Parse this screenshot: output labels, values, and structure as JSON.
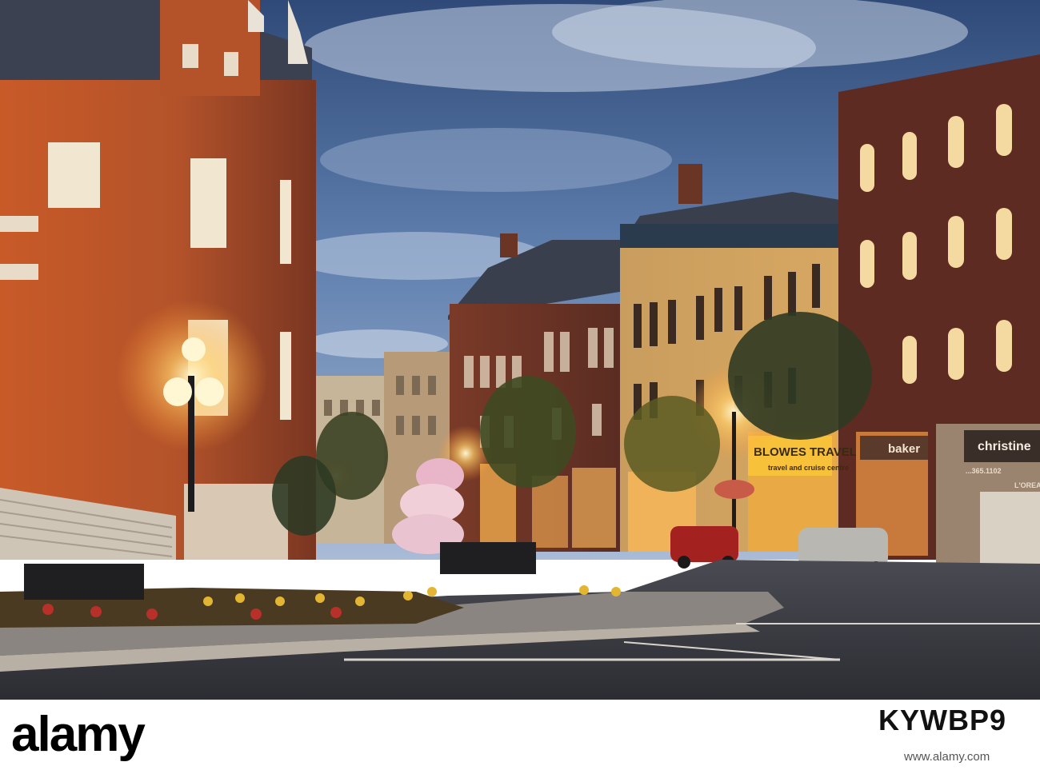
{
  "scene": {
    "signs": {
      "travel_name": "BLOWES TRAVEL",
      "travel_sub": "travel and cruise centre",
      "baker": "baker",
      "christine": "christine",
      "phone": "...365.1102",
      "loreal": "L'OREAL"
    },
    "colors": {
      "sky_top": "#3e5a88",
      "sky_bottom": "#8ba4c7",
      "brick_lit": "#c8642e",
      "brick_dark": "#6e2f1f",
      "lamp_glow": "#ffd27a",
      "road": "#3a3a40"
    }
  },
  "watermark": {
    "logo": "alamy",
    "image_id": "KYWBP9",
    "credit_line": "www.alamy.com",
    "url": "www.alamy.com"
  }
}
